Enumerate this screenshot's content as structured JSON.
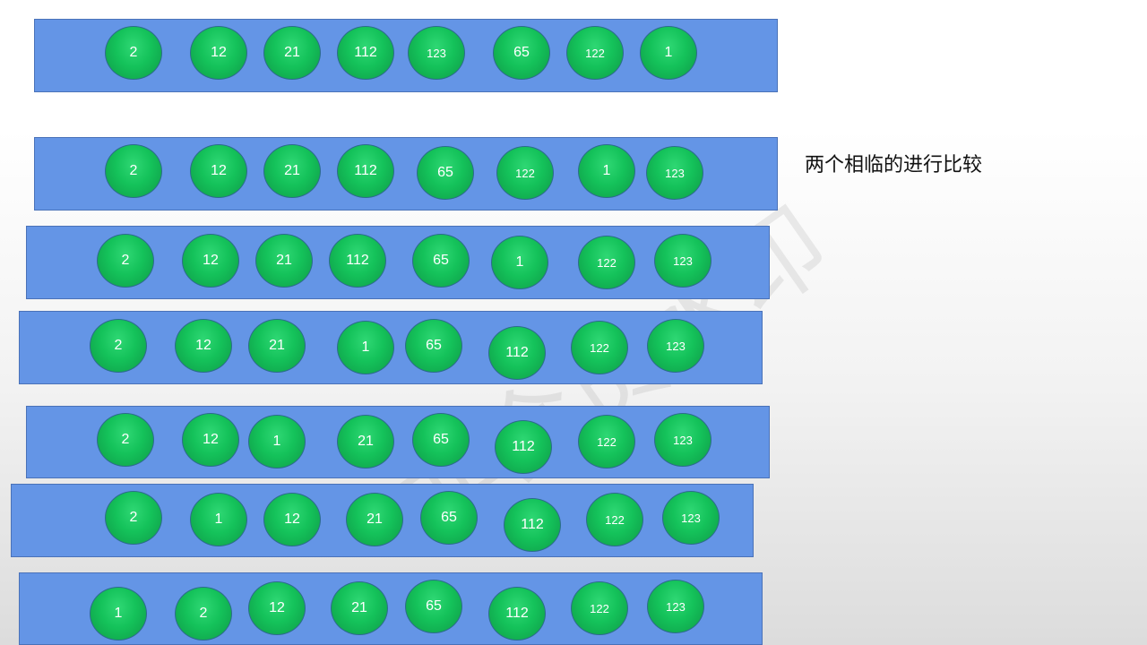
{
  "caption": "两个相临的进行比较",
  "watermark": "非会员水印",
  "rows": [
    [
      "2",
      "12",
      "21",
      "112",
      "123",
      "65",
      "122",
      "1"
    ],
    [
      "2",
      "12",
      "21",
      "112",
      "65",
      "122",
      "1",
      "123"
    ],
    [
      "2",
      "12",
      "21",
      "112",
      "65",
      "1",
      "122",
      "123"
    ],
    [
      "2",
      "12",
      "21",
      "1",
      "65",
      "112",
      "122",
      "123"
    ],
    [
      "2",
      "12",
      "1",
      "21",
      "65",
      "112",
      "122",
      "123"
    ],
    [
      "2",
      "1",
      "12",
      "21",
      "65",
      "112",
      "122",
      "123"
    ],
    [
      "1",
      "2",
      "12",
      "21",
      "65",
      "112",
      "122",
      "123"
    ]
  ],
  "colors": {
    "row_fill": "#6495e6",
    "ball_fill": "#14c25a",
    "ball_text": "#ffffff"
  }
}
